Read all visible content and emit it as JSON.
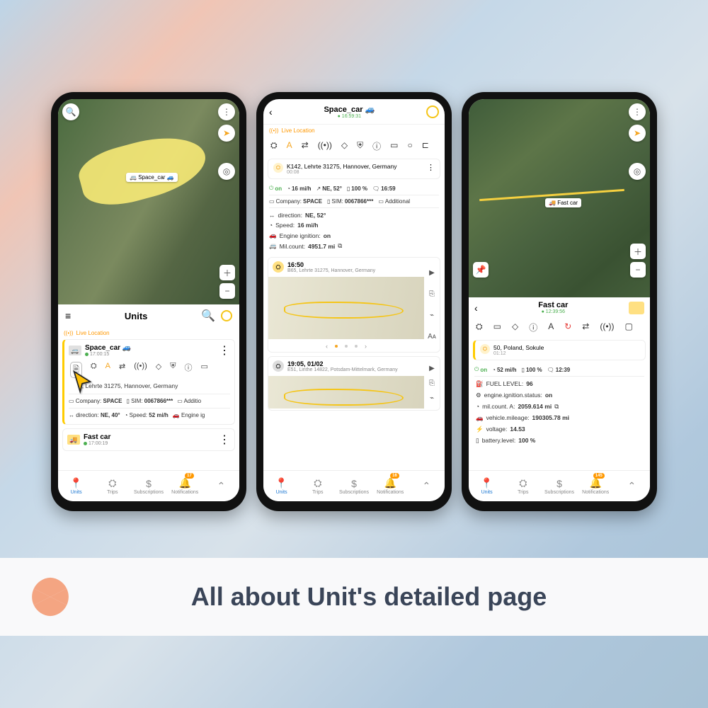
{
  "banner": {
    "title": "All about Unit's detailed page"
  },
  "nav": {
    "units": "Units",
    "trips": "Trips",
    "subs": "Subscriptions",
    "notif": "Notifications",
    "badge1": "17",
    "badge2": "16",
    "badge3": "145"
  },
  "icons": {
    "search": "🔍",
    "menu": "≡",
    "more": "⋮",
    "back": "‹",
    "target": "◎",
    "compass": "➤",
    "plus": "＋",
    "minus": "−",
    "doc": "🗎",
    "engine": "⛭",
    "gps": "A",
    "route": "⇄",
    "signal": "((•))",
    "geo": "◇",
    "shield": "⛨",
    "info": "ⓘ",
    "card": "▭",
    "circle": "○",
    "play": "▶",
    "paste": "⎘",
    "wave": "⌁",
    "font": "Aᴀ"
  },
  "phone1": {
    "sheet_title": "Units",
    "live": "Live Location",
    "map_label": "Space_car 🚙",
    "unit1": {
      "name": "Space_car 🚙",
      "time": "17:00:15",
      "address": "5, Lehrte 31275, Hannover, Germany",
      "company_l": "Company:",
      "company_v": "SPACE",
      "sim_l": "SIM:",
      "sim_v": "0067866***",
      "add": "Additio",
      "dir_l": "direction:",
      "dir_v": "NE, 40°",
      "spd_l": "Speed:",
      "spd_v": "52 mi/h",
      "eng": "Engine ig"
    },
    "unit2": {
      "name": "Fast car",
      "time": "17:00:19"
    }
  },
  "phone2": {
    "title": "Space_car 🚙",
    "time": "16:59:31",
    "live": "Live Location",
    "loc": {
      "addr": "K142, Lehrte 31275, Hannover, Germany",
      "dur": "00:08"
    },
    "stats": {
      "on": "on",
      "speed": "16 mi/h",
      "dir": "NE, 52°",
      "bat": "100 %",
      "time": "16:59"
    },
    "meta": {
      "company_l": "Company:",
      "company_v": "SPACE",
      "sim_l": "SIM:",
      "sim_v": "0067866***",
      "add": "Additional"
    },
    "details": {
      "dir_l": "direction:",
      "dir_v": "NE, 52°",
      "spd_l": "Speed:",
      "spd_v": "16 mi/h",
      "eng_l": "Engine ignition:",
      "eng_v": "on",
      "mil_l": "Mil.count:",
      "mil_v": "4951.7 mi"
    },
    "trip1": {
      "time": "16:50",
      "addr": "B65, Lehrte 31275, Hannover, Germany"
    },
    "trip2": {
      "time": "19:05, 01/02",
      "addr": "E51, Linthe 14822, Potsdam-Mittelmark, Germany"
    }
  },
  "phone3": {
    "map_label": "Fast car",
    "title": "Fast car",
    "time": "12:39:56",
    "loc": {
      "addr": "50, Poland, Sokule",
      "dur": "01:12"
    },
    "stats": {
      "on": "on",
      "speed": "52 mi/h",
      "bat": "100 %",
      "time": "12:39"
    },
    "sensors": {
      "fuel_l": "FUEL LEVEL:",
      "fuel_v": "96",
      "ign_l": "engine.ignition.status:",
      "ign_v": "on",
      "mila_l": "mil.count. A:",
      "mila_v": "2059.614 mi",
      "vmi_l": "vehicle.mileage:",
      "vmi_v": "190305.78 mi",
      "volt_l": "voltage:",
      "volt_v": "14.53",
      "batt_l": "battery.level:",
      "batt_v": "100 %"
    }
  }
}
